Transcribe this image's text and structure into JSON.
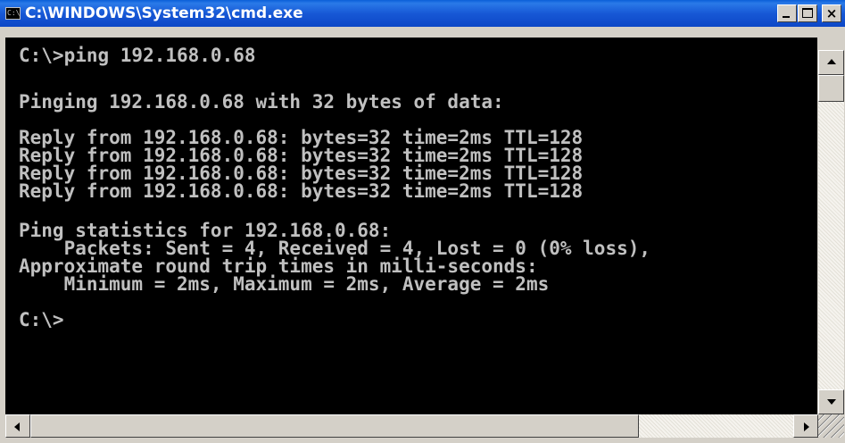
{
  "window": {
    "title": "C:\\WINDOWS\\System32\\cmd.exe",
    "icon": "cmd-app-icon",
    "icon_text": "C:\\",
    "controls": {
      "minimize_icon": "minimize-icon",
      "maximize_icon": "maximize-icon",
      "close_label": "×"
    }
  },
  "console": {
    "background": "#000000",
    "foreground": "#c0c0c0",
    "lines": [
      "C:\\>ping 192.168.0.68",
      "",
      "Pinging 192.168.0.68 with 32 bytes of data:",
      "",
      "Reply from 192.168.0.68: bytes=32 time=2ms TTL=128",
      "Reply from 192.168.0.68: bytes=32 time=2ms TTL=128",
      "Reply from 192.168.0.68: bytes=32 time=2ms TTL=128",
      "Reply from 192.168.0.68: bytes=32 time=2ms TTL=128",
      "",
      "Ping statistics for 192.168.0.68:",
      "    Packets: Sent = 4, Received = 4, Lost = 0 (0% loss),",
      "Approximate round trip times in milli-seconds:",
      "    Minimum = 2ms, Maximum = 2ms, Average = 2ms",
      "",
      "C:\\>"
    ]
  },
  "scrollbars": {
    "vertical": {
      "up_icon": "scroll-up-arrow-icon",
      "down_icon": "scroll-down-arrow-icon"
    },
    "horizontal": {
      "left_icon": "scroll-left-arrow-icon",
      "right_icon": "scroll-right-arrow-icon"
    },
    "titlebar_color": "#0a5fd8"
  }
}
